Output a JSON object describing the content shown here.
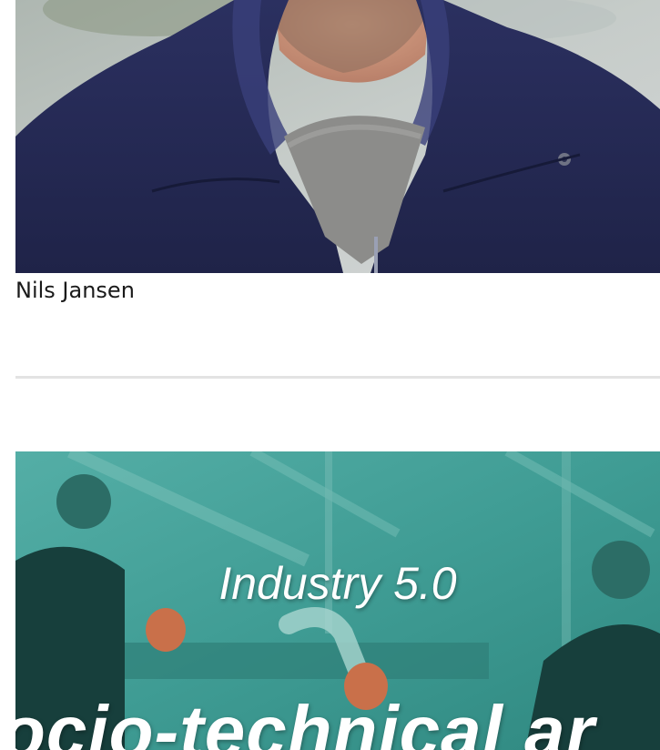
{
  "profile": {
    "name": "Nils Jansen",
    "photo_alt": "portrait-photo"
  },
  "teaser": {
    "title": "Industry 5.0",
    "subtitle": "ocio-technical ar"
  },
  "colors": {
    "jacket": "#252a52",
    "teaser_teal": "#3c9a93",
    "divider": "#e3e3e3",
    "text": "#1a1a1a"
  }
}
